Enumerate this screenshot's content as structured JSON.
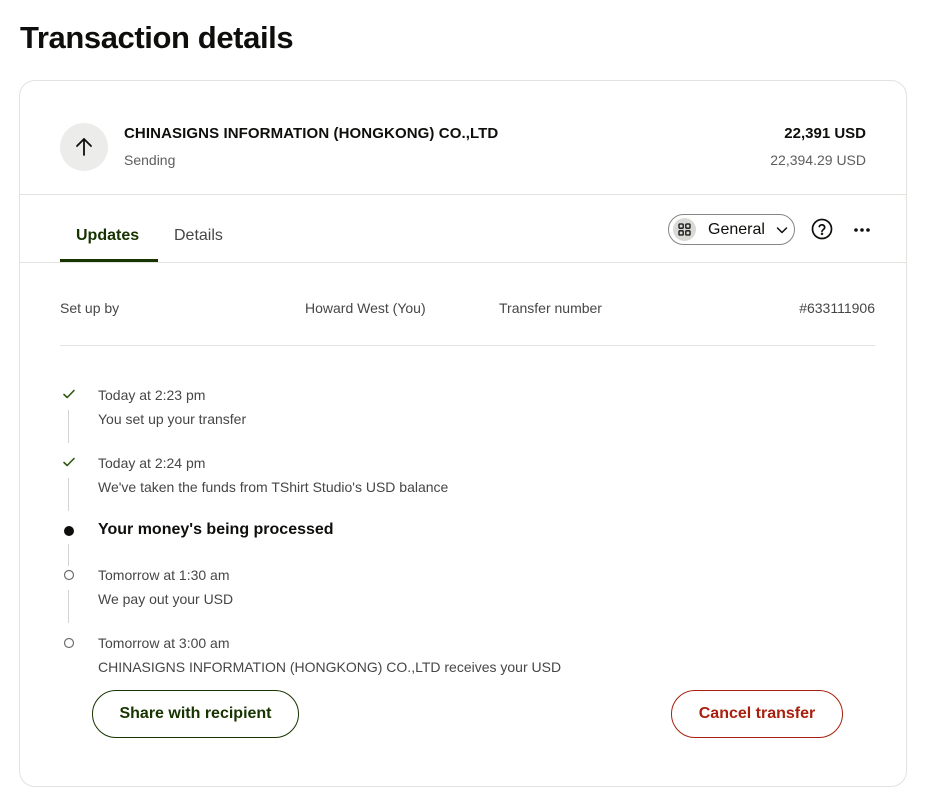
{
  "page": {
    "title": "Transaction details"
  },
  "transaction": {
    "direction_icon": "arrow-up-icon",
    "recipient": "CHINASIGNS INFORMATION (HONGKONG) CO.,LTD",
    "status": "Sending",
    "amount": "22,391 USD",
    "source_amount": "22,394.29 USD"
  },
  "tabs": [
    {
      "label": "Updates",
      "active": true
    },
    {
      "label": "Details",
      "active": false
    }
  ],
  "toolbar": {
    "view_label": "General",
    "view_icon": "grid-icon",
    "help_icon": "question-circle-icon",
    "more_icon": "more-horizontal-icon"
  },
  "info": {
    "setup_label": "Set up by",
    "setup_value": "Howard West (You)",
    "transfer_label": "Transfer number",
    "transfer_value": "#633111906"
  },
  "timeline": [
    {
      "state": "done",
      "time": "Today at 2:23 pm",
      "description": "You set up your transfer"
    },
    {
      "state": "done",
      "time": "Today at 2:24 pm",
      "description": "We've taken the funds from TShirt Studio's USD balance"
    },
    {
      "state": "current",
      "title": "Your money's being processed"
    },
    {
      "state": "pending",
      "time": "Tomorrow at 1:30 am",
      "description": "We pay out your USD"
    },
    {
      "state": "pending",
      "time": "Tomorrow at 3:00 am",
      "description": "CHINASIGNS INFORMATION (HONGKONG) CO.,LTD receives your USD"
    }
  ],
  "actions": {
    "share_label": "Share with recipient",
    "cancel_label": "Cancel transfer"
  },
  "colors": {
    "accent": "#163300",
    "check": "#2f5711",
    "danger": "#a8200d",
    "muted": "#454745"
  }
}
